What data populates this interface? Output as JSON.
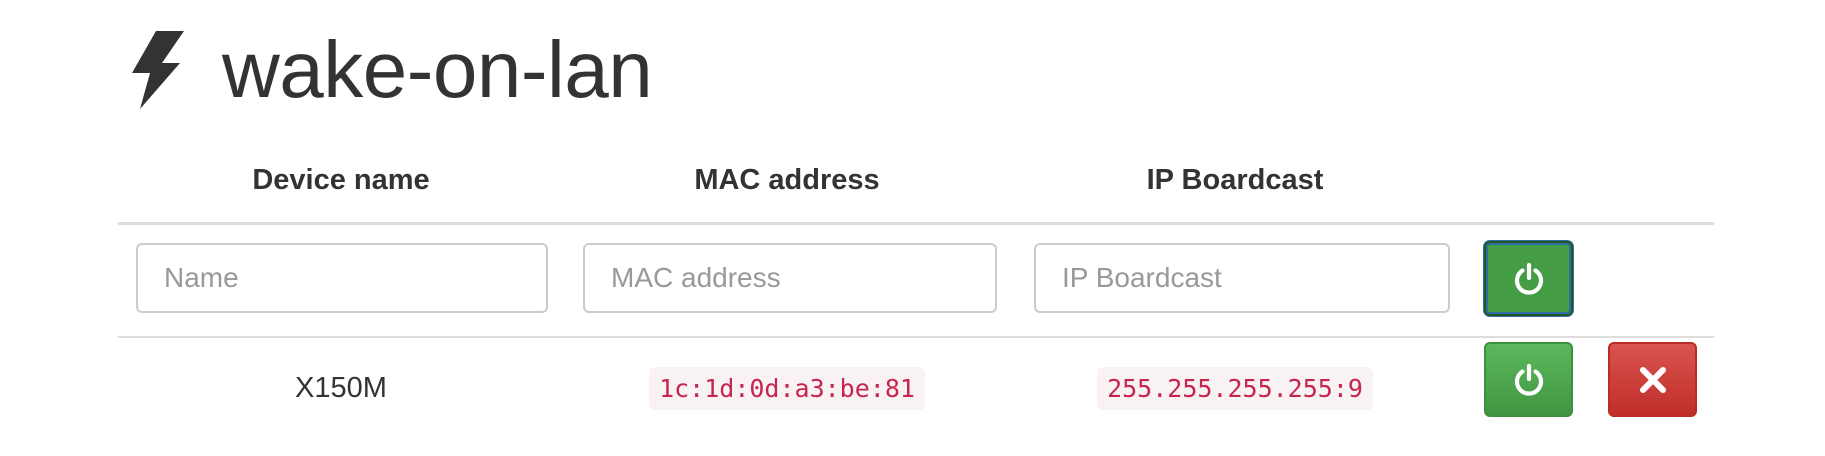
{
  "app": {
    "title": "wake-on-lan",
    "icon": "bolt-icon"
  },
  "table": {
    "headers": [
      "Device name",
      "MAC address",
      "IP Boardcast"
    ],
    "new_device": {
      "name_placeholder": "Name",
      "mac_placeholder": "MAC address",
      "ip_placeholder": "IP Boardcast",
      "add_button_icon": "power-icon"
    },
    "devices": [
      {
        "name": "X150M",
        "mac": "1c:1d:0d:a3:be:81",
        "ip": "255.255.255.255:9",
        "wake_button_icon": "power-icon",
        "delete_button_icon": "close-icon"
      }
    ]
  },
  "colors": {
    "success": "#5cb85c",
    "danger": "#d9534f",
    "code_text": "#c7254e",
    "code_bg": "#f9f2f4",
    "focus_outline": "#2e6da4"
  }
}
